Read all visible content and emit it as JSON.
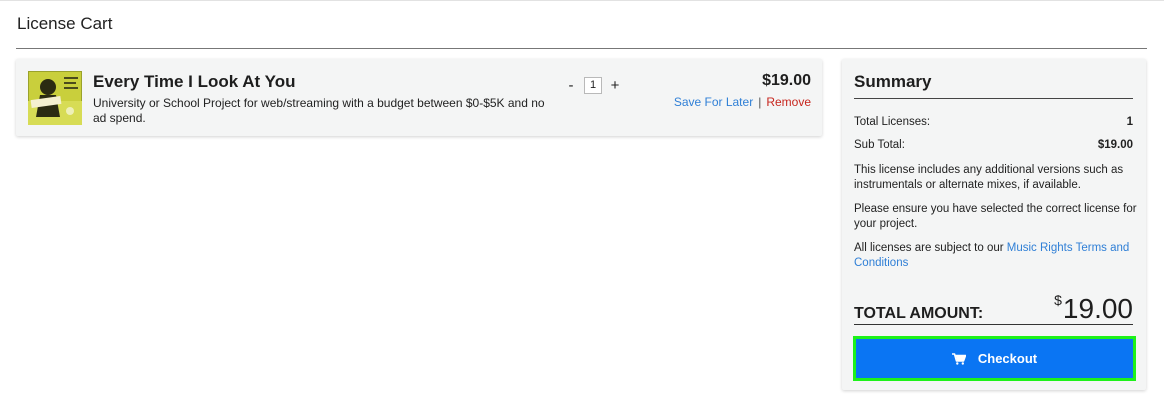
{
  "page": {
    "title": "License Cart"
  },
  "cart": {
    "item": {
      "title": "Every Time I Look At You",
      "description": "University or School Project for web/streaming with a budget between $0-$5K and no ad spend.",
      "quantity": "1",
      "price": "$19.00",
      "save_label": "Save For Later",
      "separator": "|",
      "remove_label": "Remove",
      "decrement_label": "-",
      "increment_label": "+"
    }
  },
  "summary": {
    "title": "Summary",
    "total_licenses_label": "Total Licenses:",
    "total_licenses_value": "1",
    "subtotal_label": "Sub Total:",
    "subtotal_value": "$19.00",
    "note_versions": "This license includes any additional versions such as instrumentals or alternate mixes, if available.",
    "note_ensure": "Please ensure you have selected the correct license for your project.",
    "note_terms_prefix": "All licenses are subject to our ",
    "terms_link": "Music Rights Terms and Conditions",
    "total_label": "TOTAL AMOUNT:",
    "total_currency": "$",
    "total_value": "19.00",
    "checkout_label": "Checkout"
  },
  "colors": {
    "accent_blue": "#0a75f3",
    "link_blue": "#2f7fd6",
    "remove_red": "#c7261e",
    "highlight_green": "#1ef11a",
    "card_bg": "#f4f5f5"
  }
}
